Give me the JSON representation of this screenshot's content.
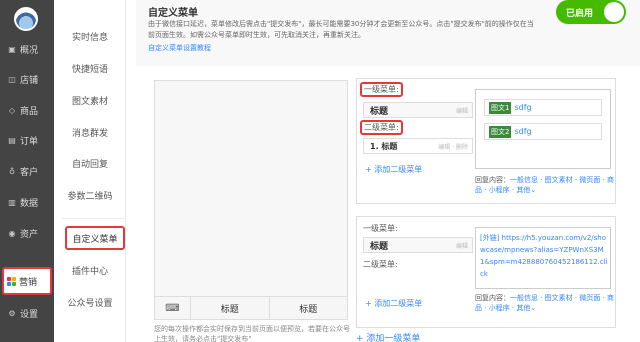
{
  "nav": {
    "items": [
      {
        "icon": "▣",
        "label": "概况"
      },
      {
        "icon": "◫",
        "label": "店铺"
      },
      {
        "icon": "◇",
        "label": "商品"
      },
      {
        "icon": "▤",
        "label": "订单"
      },
      {
        "icon": "♁",
        "label": "客户"
      },
      {
        "icon": "▥",
        "label": "数据"
      },
      {
        "icon": "◉",
        "label": "资产"
      },
      {
        "icon": "grid",
        "label": "营销"
      },
      {
        "icon": "⚙",
        "label": "设置"
      }
    ]
  },
  "subnav": {
    "items": [
      "实时信息",
      "快捷短语",
      "图文素材",
      "消息群发",
      "自动回复",
      "参数二维码"
    ],
    "active": "自定义菜单",
    "lower": [
      "插件中心",
      "公众号设置"
    ]
  },
  "header": {
    "title": "自定义菜单",
    "desc": "由于微信接口延迟，菜单修改后需点击\"提交发布\"，最长可能需要30分钟才会更新至公众号。点击\"提交发布\"前的操作仅在当前页面生效。如需公众号菜单即时生效，可先取消关注，再重新关注。",
    "link": "自定义菜单设置教程",
    "toggle": "已启用"
  },
  "phone": {
    "keyboard": "⌨",
    "menus": [
      "标题",
      "标题"
    ],
    "note": "您的每次操作都会实时保存到当前页面以便预览，若要在公众号上生效，请务必点击\"提交发布\""
  },
  "card1": {
    "level1_label": "一级菜单:",
    "title": "标题",
    "edit": "编辑",
    "level2_label": "二级菜单:",
    "sub_title": "1. 标题",
    "sub_ops": "编辑 · 删除",
    "add_sub": "+ 添加二级菜单",
    "articles": [
      {
        "tag": "图文1",
        "text": "sdfg"
      },
      {
        "tag": "图文2",
        "text": "sdfg"
      }
    ],
    "reply_prefix": "回复内容：",
    "reply_links": "一般信息 · 图文素材 · 微页面 · 商品 · 小程序 · 其他⌄"
  },
  "card2": {
    "level1_label": "一级菜单:",
    "title": "标题",
    "edit": "编辑",
    "level2_label": "二级菜单:",
    "add_sub": "+ 添加二级菜单",
    "external": "[外链] https://h5.youzan.com/v2/showcase/mpnews?alias=YZPWnXS3M1&spm=m428880760452186112.click",
    "reply_prefix": "回复内容：",
    "reply_links": "一般信息 · 图文素材 · 微页面 · 商品 · 小程序 · 其他⌄"
  },
  "add_level1": "+ 添加一级菜单"
}
